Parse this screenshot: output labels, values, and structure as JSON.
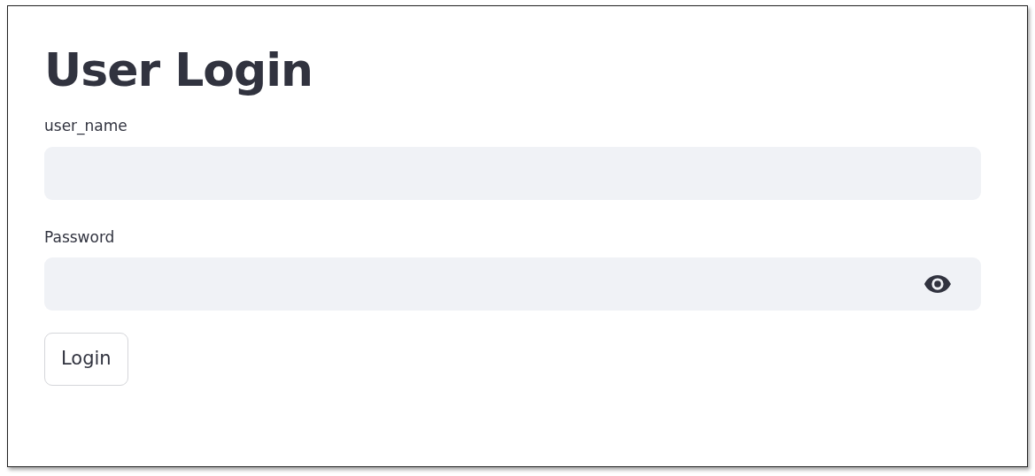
{
  "title": "User Login",
  "fields": [
    {
      "label": "user_name",
      "kind": "text"
    },
    {
      "label": "Password",
      "kind": "password"
    }
  ],
  "button": "Login"
}
